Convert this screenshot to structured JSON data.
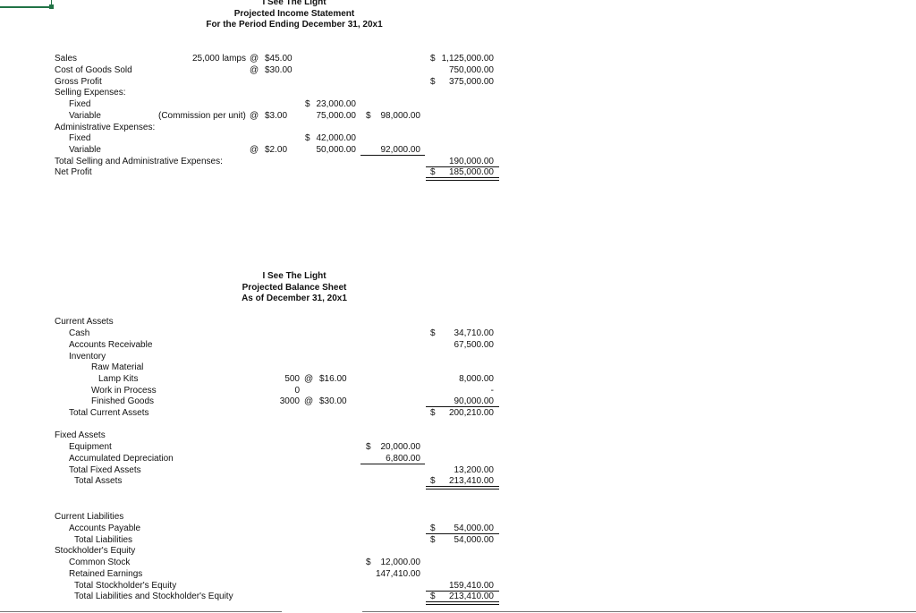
{
  "income_statement": {
    "title": [
      "I See The Light",
      "Projected Income Statement",
      "For the Period Ending December 31, 20x1"
    ],
    "rows": {
      "sales": {
        "label": "Sales",
        "qty": "25,000 lamps",
        "at": "@",
        "rate": "$45.00",
        "dollar": "$",
        "total": "1,125,000.00"
      },
      "cogs": {
        "label": "Cost of Goods Sold",
        "at": "@",
        "rate": "$30.00",
        "total": "750,000.00"
      },
      "gross_profit": {
        "label": "Gross Profit",
        "dollar": "$",
        "total": "375,000.00"
      },
      "selling_header": {
        "label": "Selling Expenses:"
      },
      "selling_fixed": {
        "label": "Fixed",
        "dollar": "$",
        "amount": "23,000.00"
      },
      "selling_variable": {
        "label": "Variable",
        "note": "(Commission per unit)",
        "at": "@",
        "rate": "$3.00",
        "amount": "75,000.00",
        "sub_dollar": "$",
        "subtotal": "98,000.00"
      },
      "admin_header": {
        "label": "Administrative Expenses:"
      },
      "admin_fixed": {
        "label": "Fixed",
        "dollar": "$",
        "amount": "42,000.00"
      },
      "admin_variable": {
        "label": "Variable",
        "at": "@",
        "rate": "$2.00",
        "amount": "50,000.00",
        "subtotal": "92,000.00"
      },
      "total_sa": {
        "label": "Total Selling and Administrative Expenses:",
        "total": "190,000.00"
      },
      "net_profit": {
        "label": "Net Profit",
        "dollar": "$",
        "total": "185,000.00"
      }
    }
  },
  "balance_sheet": {
    "title": [
      "I See The Light",
      "Projected Balance Sheet",
      "As of December 31, 20x1"
    ],
    "rows": {
      "current_assets": {
        "label": "Current Assets"
      },
      "cash": {
        "label": "Cash",
        "dollar": "$",
        "total": "34,710.00"
      },
      "ar": {
        "label": "Accounts Receivable",
        "total": "67,500.00"
      },
      "inventory": {
        "label": "Inventory"
      },
      "raw_material": {
        "label": "Raw Material"
      },
      "lamp_kits": {
        "label": "Lamp Kits",
        "qty": "500",
        "at": "@",
        "rate": "$16.00",
        "total": "8,000.00"
      },
      "wip": {
        "label": "Work in Process",
        "qty": "0",
        "total": "-"
      },
      "finished_goods": {
        "label": "Finished Goods",
        "qty": "3000",
        "at": "@",
        "rate": "$30.00",
        "total": "90,000.00"
      },
      "total_current": {
        "label": "Total Current Assets",
        "dollar": "$",
        "total": "200,210.00"
      },
      "fixed_assets": {
        "label": "Fixed Assets"
      },
      "equipment": {
        "label": "Equipment",
        "dollar": "$",
        "amount": "20,000.00"
      },
      "accum_dep": {
        "label": "Accumulated Depreciation",
        "amount": "6,800.00"
      },
      "total_fixed": {
        "label": "Total Fixed Assets",
        "total": "13,200.00"
      },
      "total_assets": {
        "label": "Total Assets",
        "dollar": "$",
        "total": "213,410.00"
      },
      "current_liabilities": {
        "label": "Current Liabilities"
      },
      "ap": {
        "label": "Accounts Payable",
        "dollar": "$",
        "total": "54,000.00"
      },
      "total_liabilities": {
        "label": "Total Liabilities",
        "dollar": "$",
        "total": "54,000.00"
      },
      "equity": {
        "label": "Stockholder's Equity"
      },
      "common_stock": {
        "label": "Common Stock",
        "dollar": "$",
        "amount": "12,000.00"
      },
      "retained_earnings": {
        "label": "Retained Earnings",
        "amount": "147,410.00"
      },
      "total_equity": {
        "label": "Total Stockholder's Equity",
        "total": "159,410.00"
      },
      "total_le": {
        "label": "Total Liabilities and Stockholder's Equity",
        "dollar": "$",
        "total": "213,410.00"
      }
    }
  },
  "colors": {
    "selection": "#217346"
  }
}
